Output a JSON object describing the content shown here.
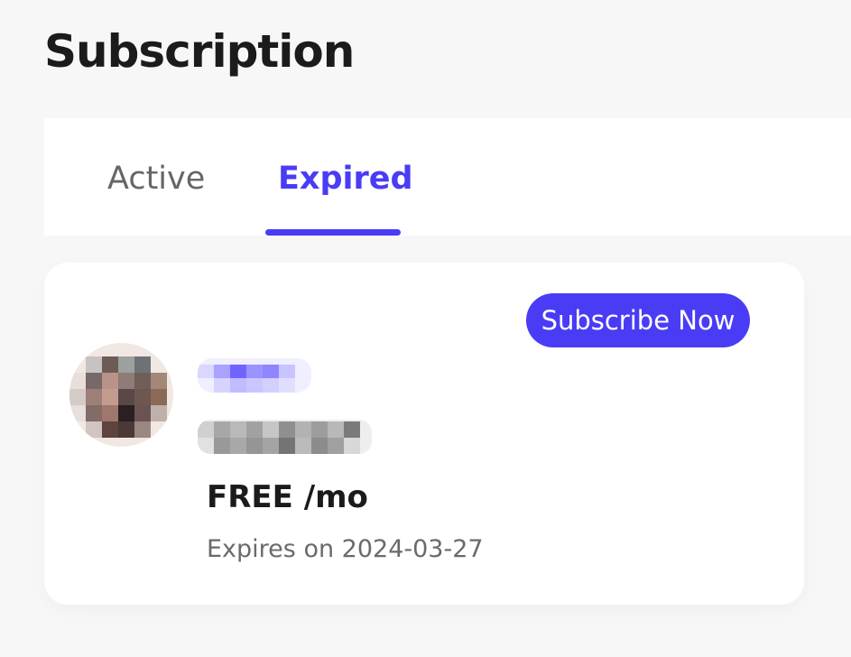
{
  "page": {
    "title": "Subscription"
  },
  "tabs": [
    {
      "label": "Active",
      "selected": false
    },
    {
      "label": "Expired",
      "selected": true
    }
  ],
  "subscription": {
    "button_label": "Subscribe Now",
    "price": "FREE /mo",
    "expires": "Expires on 2024-03-27"
  },
  "colors": {
    "accent": "#4a3cf5",
    "page_background": "#f7f7f7",
    "card_background": "#ffffff",
    "primary_text": "#1b1b1b",
    "secondary_text": "#6a6a6a"
  }
}
